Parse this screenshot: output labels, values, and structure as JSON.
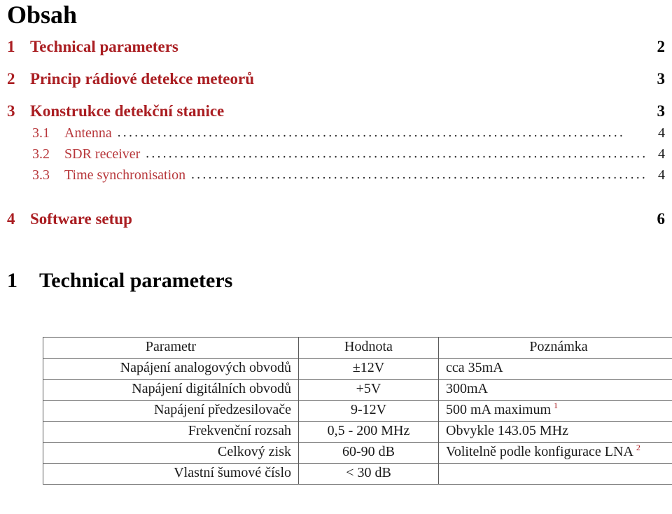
{
  "document": {
    "toc_heading": "Obsah",
    "section_heading": {
      "number": "1",
      "title": "Technical parameters"
    }
  },
  "toc": {
    "entries": [
      {
        "number": "1",
        "label": "Technical parameters",
        "page": "2",
        "level": "section",
        "leader": false
      },
      {
        "number": "2",
        "label": "Princip rádiové detekce meteorů",
        "page": "3",
        "level": "section",
        "leader": false
      },
      {
        "number": "3",
        "label": "Konstrukce detekční stanice",
        "page": "3",
        "level": "section",
        "leader": false
      },
      {
        "number": "3.1",
        "label": "Antenna",
        "page": "4",
        "level": "subsection",
        "leader": true
      },
      {
        "number": "3.2",
        "label": "SDR receiver",
        "page": "4",
        "level": "subsection",
        "leader": true
      },
      {
        "number": "3.3",
        "label": "Time synchronisation",
        "page": "4",
        "level": "subsection",
        "leader": true
      },
      {
        "number": "4",
        "label": "Software setup",
        "page": "6",
        "level": "section",
        "leader": false
      }
    ]
  },
  "param_table": {
    "headers": [
      "Parametr",
      "Hodnota",
      "Poznámka"
    ],
    "rows": [
      {
        "parametr": "Napájení analogových obvodů",
        "hodnota": "±12V",
        "poznamka": "cca 35mA",
        "footnote": ""
      },
      {
        "parametr": "Napájení digitálních obvodů",
        "hodnota": "+5V",
        "poznamka": "300mA",
        "footnote": ""
      },
      {
        "parametr": "Napájení předzesilovače",
        "hodnota": "9-12V",
        "poznamka": "500 mA maximum",
        "footnote": "1"
      },
      {
        "parametr": "Frekvenční rozsah",
        "hodnota": "0,5 - 200 MHz",
        "poznamka": "Obvykle 143.05 MHz",
        "footnote": ""
      },
      {
        "parametr": "Celkový zisk",
        "hodnota": "60-90 dB",
        "poznamka": "Volitelně podle konfigurace LNA",
        "footnote": "2"
      },
      {
        "parametr": "Vlastní šumové číslo",
        "hodnota": "< 30 dB",
        "poznamka": "",
        "footnote": ""
      }
    ]
  },
  "colors": {
    "toc_link_red": "#AA1E22",
    "text_black": "#000000",
    "table_border": "#5B5B5B"
  }
}
